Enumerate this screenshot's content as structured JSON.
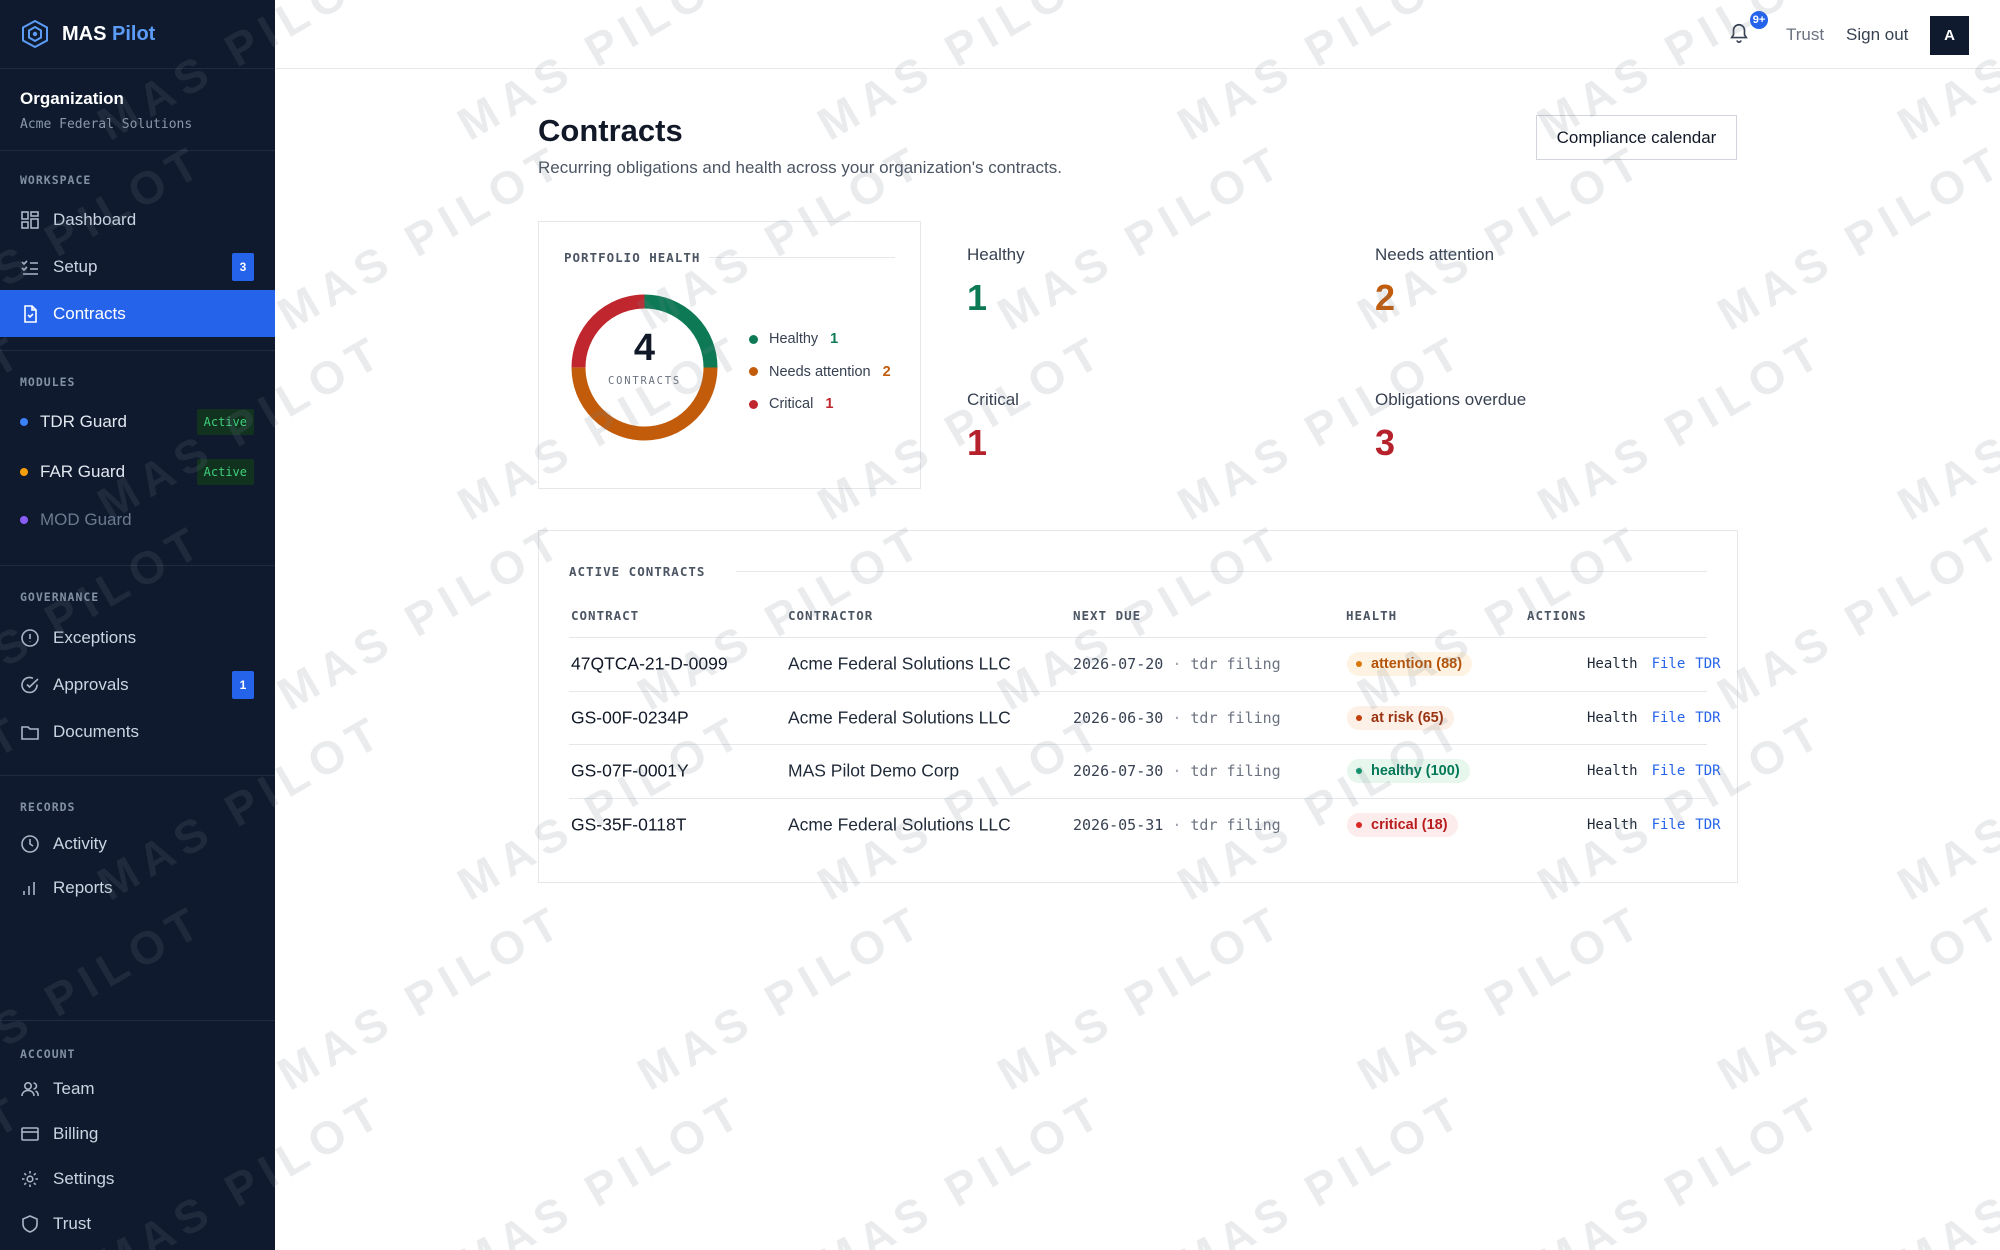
{
  "brand": {
    "name": "MAS",
    "accent": "Pilot"
  },
  "org": {
    "title": "Organization",
    "name": "Acme Federal Solutions"
  },
  "sidebar": {
    "workspace": {
      "title": "WORKSPACE",
      "items": [
        {
          "label": "Dashboard",
          "icon": "grid-icon"
        },
        {
          "label": "Setup",
          "icon": "checklist-icon",
          "badge": "3"
        },
        {
          "label": "Contracts",
          "icon": "document-icon"
        }
      ]
    },
    "modules": {
      "title": "MODULES",
      "items": [
        {
          "label": "TDR Guard",
          "dot_color": "#3b82f6",
          "tag": "Active"
        },
        {
          "label": "FAR Guard",
          "dot_color": "#f59e0b",
          "tag": "Active"
        },
        {
          "label": "MOD Guard",
          "dot_color": "#8b5cf6"
        }
      ]
    },
    "governance": {
      "title": "GOVERNANCE",
      "items": [
        {
          "label": "Exceptions",
          "icon": "alert-circle-icon"
        },
        {
          "label": "Approvals",
          "icon": "check-circle-icon",
          "badge": "1"
        },
        {
          "label": "Documents",
          "icon": "folder-icon"
        }
      ]
    },
    "records": {
      "title": "RECORDS",
      "items": [
        {
          "label": "Activity",
          "icon": "clock-icon"
        },
        {
          "label": "Reports",
          "icon": "bar-chart-icon"
        }
      ]
    },
    "account": {
      "title": "ACCOUNT",
      "items": [
        {
          "label": "Team",
          "icon": "users-icon"
        },
        {
          "label": "Billing",
          "icon": "credit-card-icon"
        },
        {
          "label": "Settings",
          "icon": "gear-icon"
        },
        {
          "label": "Trust",
          "icon": "shield-icon"
        }
      ]
    }
  },
  "topbar": {
    "notification_badge": "9+",
    "trust": "Trust",
    "signout": "Sign out",
    "avatar": "A"
  },
  "page": {
    "title": "Contracts",
    "subtitle": "Recurring obligations and health across your organization's contracts.",
    "calendar_button": "Compliance calendar"
  },
  "portfolio": {
    "title": "PORTFOLIO HEALTH",
    "total": "4",
    "total_label": "CONTRACTS",
    "legend": [
      {
        "label": "Healthy",
        "value": "1",
        "color": "#0d7a55"
      },
      {
        "label": "Needs attention",
        "value": "2",
        "color": "#c25b0a"
      },
      {
        "label": "Critical",
        "value": "1",
        "color": "#c0262d"
      }
    ]
  },
  "stats": [
    {
      "label": "Healthy",
      "value": "1",
      "color": "#0d7a55"
    },
    {
      "label": "Needs attention",
      "value": "2",
      "color": "#c25b0a"
    },
    {
      "label": "Critical",
      "value": "1",
      "color": "#b5222b"
    },
    {
      "label": "Obligations overdue",
      "value": "3",
      "color": "#b5222b"
    }
  ],
  "contracts_table": {
    "title": "ACTIVE CONTRACTS",
    "headers": [
      "CONTRACT",
      "CONTRACTOR",
      "NEXT DUE",
      "HEALTH",
      "ACTIONS"
    ],
    "rows": [
      {
        "contract": "47QTCA-21-D-0099",
        "contractor": "Acme Federal Solutions LLC",
        "due": "2026-07-20",
        "kind": "tdr filing",
        "health": "attention (88)",
        "status": "attention"
      },
      {
        "contract": "GS-00F-0234P",
        "contractor": "Acme Federal Solutions LLC",
        "due": "2026-06-30",
        "kind": "tdr filing",
        "health": "at risk (65)",
        "status": "risk"
      },
      {
        "contract": "GS-07F-0001Y",
        "contractor": "MAS Pilot Demo Corp",
        "due": "2026-07-30",
        "kind": "tdr filing",
        "health": "healthy (100)",
        "status": "healthy"
      },
      {
        "contract": "GS-35F-0118T",
        "contractor": "Acme Federal Solutions LLC",
        "due": "2026-05-31",
        "kind": "tdr filing",
        "health": "critical (18)",
        "status": "critical"
      }
    ],
    "actions": {
      "health": "Health",
      "file": "File",
      "tdr": "TDR"
    }
  },
  "status_colors": {
    "attention": {
      "fg": "#b45309",
      "bg": "#fef3e2",
      "dot": "#d97706"
    },
    "risk": {
      "fg": "#9a3412",
      "bg": "#fdf0e6",
      "dot": "#c2410c"
    },
    "healthy": {
      "fg": "#047857",
      "bg": "#e7f7ee",
      "dot": "#059669"
    },
    "critical": {
      "fg": "#b91c1c",
      "bg": "#fdecec",
      "dot": "#dc2626"
    }
  },
  "watermark": "MAS PILOT"
}
